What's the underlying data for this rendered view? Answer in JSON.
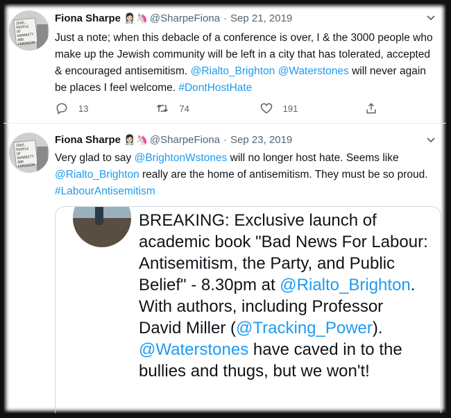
{
  "tweets": [
    {
      "author_name": "Fiona Sharpe",
      "author_emojis": "👩🏻‍⚕️🦄",
      "handle": "@SharpeFiona",
      "date": "Sep 21, 2019",
      "text_parts": [
        "Just a note; when this debacle of a conference is over, I & the 3000 people who make up the Jewish community will be left in a city that has tolerated, accepted & encouraged antisemitism.  ",
        "@Rialto_Brighton",
        " ",
        "@Waterstones",
        " will never again be places I feel welcome. ",
        "#DontHostHate"
      ],
      "replies": "13",
      "retweets": "74",
      "likes": "191"
    },
    {
      "author_name": "Fiona Sharpe",
      "author_emojis": "👩🏻‍⚕️🦄",
      "handle": "@SharpeFiona",
      "date": "Sep 23, 2019",
      "text_parts": [
        "Very glad to say ",
        "@BrightonWstones",
        " will no longer host hate.  Seems like ",
        "@Rialto_Brighton",
        " really are the home of antisemitism.  They must be so proud. ",
        "#LabourAntisemitism"
      ],
      "card": {
        "text_parts": [
          "BREAKING: Exclusive launch of academic book \"Bad News For Labour: Antisemitism, the Party, and Public Belief\" - 8.30pm at ",
          "@Rialto_Brighton",
          ". With authors, including Professor David Miller (",
          "@Tracking_Power",
          "). ",
          "@Waterstones",
          " have caved in to the bullies and thugs, but we won't!"
        ]
      }
    }
  ],
  "sign_text": "JEWS, PEOPLE OF HUMANITY AND FEMINISM",
  "colors": {
    "link": "#1d9bf0",
    "text": "#0f1419",
    "muted": "#536471"
  },
  "icons": [
    "reply-icon",
    "retweet-icon",
    "like-icon",
    "share-icon",
    "more-options-icon"
  ]
}
